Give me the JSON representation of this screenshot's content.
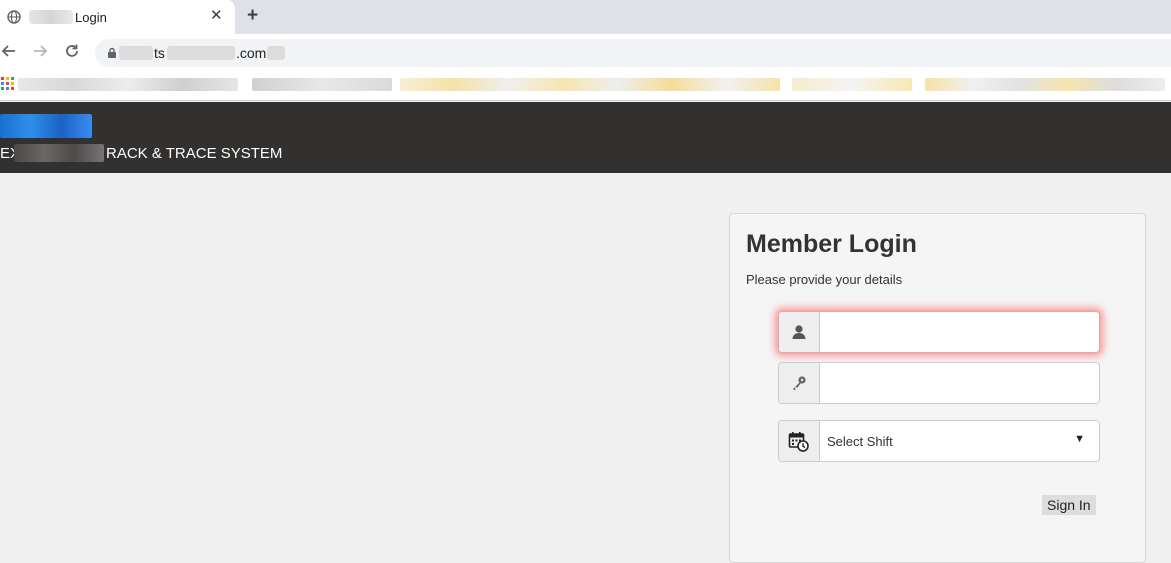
{
  "browser": {
    "tab": {
      "title": "Login",
      "close_glyph": "✕"
    },
    "new_tab_glyph": "+",
    "address": {
      "part1": "ts",
      "part2": ".com"
    }
  },
  "app": {
    "header": {
      "system_prefix": "EX",
      "system_name": "RACK & TRACE SYSTEM",
      "background_color": "#333130"
    }
  },
  "login": {
    "title": "Member Login",
    "subtitle": "Please provide your details",
    "username": {
      "value": "",
      "placeholder": "",
      "icon": "user-icon"
    },
    "password": {
      "value": "",
      "placeholder": "",
      "icon": "key-icon"
    },
    "shift": {
      "selected": "Select Shift",
      "icon": "calendar-clock-icon",
      "arrow": "▼"
    },
    "signin_label": "Sign In",
    "focus_glow_color": "#ff4646"
  }
}
